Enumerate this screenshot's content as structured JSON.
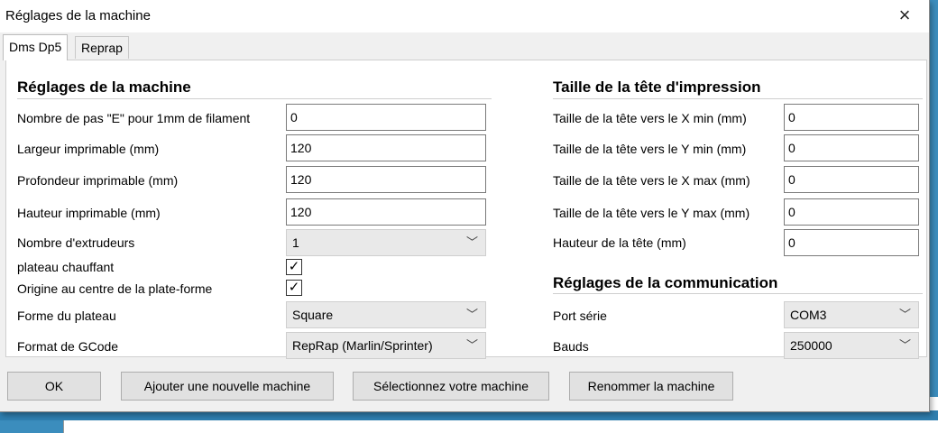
{
  "window": {
    "title": "Réglages de la machine",
    "close_icon": "×"
  },
  "tabs": [
    {
      "label": "Dms Dp5"
    },
    {
      "label": "Reprap"
    }
  ],
  "machine_section": {
    "title": "Réglages de la machine",
    "e_steps_label": "Nombre de pas \"E\" pour 1mm de filament",
    "e_steps_value": "0",
    "width_label": "Largeur imprimable (mm)",
    "width_value": "120",
    "depth_label": "Profondeur imprimable (mm)",
    "depth_value": "120",
    "height_label": "Hauteur imprimable (mm)",
    "height_value": "120",
    "extruders_label": "Nombre d'extrudeurs",
    "extruders_value": "1",
    "heated_bed_label": "plateau chauffant",
    "heated_bed_checked": "✓",
    "center_origin_label": "Origine au centre de la plate-forme",
    "center_origin_checked": "✓",
    "bed_shape_label": "Forme du plateau",
    "bed_shape_value": "Square",
    "gcode_label": "Format de GCode",
    "gcode_value": "RepRap (Marlin/Sprinter)"
  },
  "head_section": {
    "title": "Taille de la tête d'impression",
    "xmin_label": "Taille de la tête vers le X min (mm)",
    "xmin_value": "0",
    "ymin_label": "Taille de la tête vers le Y min (mm)",
    "ymin_value": "0",
    "xmax_label": "Taille de la tête vers le X max (mm)",
    "xmax_value": "0",
    "ymax_label": "Taille de la tête vers le Y max (mm)",
    "ymax_value": "0",
    "head_height_label": "Hauteur de la tête (mm)",
    "head_height_value": "0"
  },
  "comm_section": {
    "title": "Réglages de la communication",
    "port_label": "Port série",
    "port_value": "COM3",
    "baud_label": "Bauds",
    "baud_value": "250000"
  },
  "footer": {
    "ok": "OK",
    "add_machine": "Ajouter une nouvelle machine",
    "select_machine": "Sélectionnez votre machine",
    "rename_machine": "Renommer la machine"
  },
  "icons": {
    "chevron": "﹀"
  }
}
